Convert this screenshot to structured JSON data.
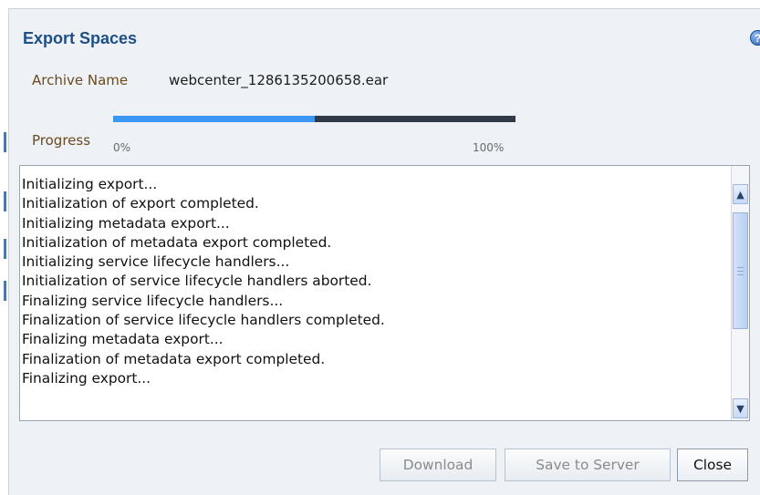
{
  "dialog": {
    "title": "Export Spaces",
    "help_icon": "?"
  },
  "archive": {
    "label": "Archive Name",
    "value": "webcenter_1286135200658.ear"
  },
  "progress": {
    "label": "Progress",
    "min_label": "0%",
    "max_label": "100%",
    "fraction": 0.5,
    "fill_color": "#3b97f1",
    "track_color": "#2f3a46"
  },
  "log": {
    "lines": [
      "Initializing export...",
      "Initialization of export completed.",
      "Initializing metadata export...",
      "Initialization of metadata export completed.",
      "Initializing service lifecycle handlers...",
      "Initialization of service lifecycle handlers aborted.",
      "Finalizing service lifecycle handlers...",
      "Finalization of service lifecycle handlers completed.",
      "Finalizing metadata export...",
      "Finalization of metadata export completed.",
      "Finalizing export..."
    ]
  },
  "buttons": {
    "download": "Download",
    "save_to_server": "Save to Server",
    "close": "Close"
  },
  "icons": {
    "scroll_up": "▲",
    "scroll_down": "▼"
  }
}
